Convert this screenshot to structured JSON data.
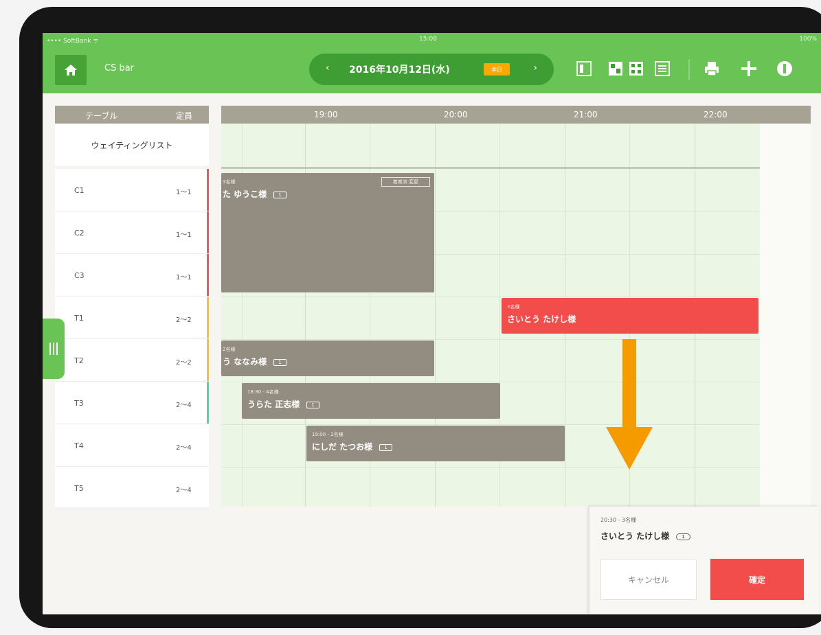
{
  "status_bar": {
    "carrier": "•••• SoftBank ᯤ",
    "time": "15:08",
    "battery": "100%"
  },
  "app_bar": {
    "shop_name": "CS bar",
    "date": {
      "prev": "‹",
      "label": "2016年10月12日(水)",
      "badge": "本日",
      "next": "›"
    }
  },
  "table_column": {
    "header_table": "テーブル",
    "header_capacity": "定員",
    "waiting_list": "ウェイティングリスト"
  },
  "tables": [
    {
      "name": "C1",
      "capacity": "1〜1",
      "color": "#e85a5a"
    },
    {
      "name": "C2",
      "capacity": "1〜1",
      "color": "#e85a5a"
    },
    {
      "name": "C3",
      "capacity": "1〜1",
      "color": "#e85a5a"
    },
    {
      "name": "T1",
      "capacity": "2〜2",
      "color": "#f1c232"
    },
    {
      "name": "T2",
      "capacity": "2〜2",
      "color": "#f1c232"
    },
    {
      "name": "T3",
      "capacity": "2〜4",
      "color": "#4fd2b0"
    },
    {
      "name": "T4",
      "capacity": "2〜4",
      "color": ""
    },
    {
      "name": "T5",
      "capacity": "2〜4",
      "color": ""
    }
  ],
  "timeline": {
    "hours": [
      "19:00",
      "20:00",
      "21:00",
      "22:00"
    ]
  },
  "reservations": [
    {
      "meta": "3名様",
      "name": "た ゆうこ様",
      "count": "1",
      "tag": "着席済 変更"
    },
    {
      "meta": "2名様",
      "name": "う ななみ様",
      "count": "1"
    },
    {
      "meta": "18:30 - 4名様",
      "name": "うらた 正志様",
      "count": "1"
    },
    {
      "meta": "19:00 - 2名様",
      "name": "にしだ たつお様",
      "count": "1"
    },
    {
      "meta": "3名様",
      "name": "さいとう たけし様"
    }
  ],
  "confirm_panel": {
    "meta": "20:30 - 3名様",
    "name": "さいとう たけし様",
    "count": "1",
    "cancel_label": "キャンセル",
    "confirm_label": "確定"
  },
  "colors": {
    "brand_green": "#6ac355",
    "accent_red": "#f24d4a",
    "arrow_orange": "#f59b00",
    "block_gray": "#928d80"
  }
}
